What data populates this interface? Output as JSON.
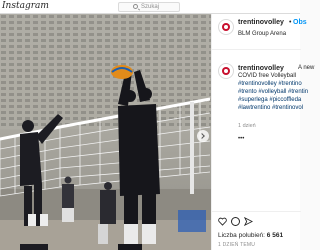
{
  "topbar": {
    "logo": "Instagram",
    "search_placeholder": "Szukaj"
  },
  "post": {
    "username": "trentinovolley",
    "separator": "•",
    "follow_label": "Obs",
    "location": "BLM Group Arena",
    "caption_username": "trentinovolley",
    "caption_lines": [
      "A new",
      "COVID free Volleyball",
      "#trentinovolley #trentino",
      "#trento #volleyball #trentin",
      "#superlega #piccoffleda",
      "#lawtrentino #trentinovol"
    ],
    "time_ago": "1 dzień",
    "likes_label": "Liczba polubień:",
    "likes_count": "6 561",
    "date": "1 DZIEŃ TEMU",
    "icons": [
      "instagram-logo",
      "search-icon",
      "avatar",
      "heart-icon",
      "comment-icon",
      "share-icon",
      "next-arrow-icon",
      "more-icon"
    ]
  }
}
